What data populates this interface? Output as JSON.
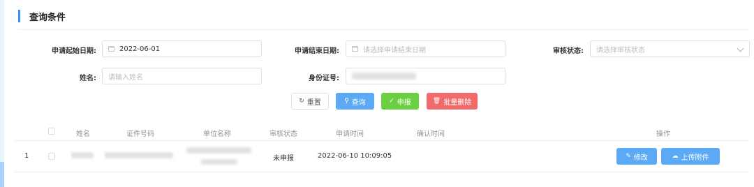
{
  "section": {
    "title": "查询条件"
  },
  "form": {
    "start_date_label": "申请起始日期:",
    "start_date_value": "2022-06-01",
    "end_date_label": "申请结束日期:",
    "end_date_placeholder": "请选择申请结束日期",
    "status_label": "审核状态:",
    "status_placeholder": "请选择审核状态",
    "name_label": "姓名:",
    "name_placeholder": "请输入姓名",
    "id_label": "身份证号:"
  },
  "buttons": {
    "reset": "重置",
    "query": "查询",
    "report": "申报",
    "batch_delete": "批量删除"
  },
  "table": {
    "headers": [
      "姓名",
      "证件号码",
      "单位名称",
      "审核状态",
      "申请时间",
      "确认时间",
      "操作"
    ],
    "rows": [
      {
        "index": "1",
        "status": "未申报",
        "apply_time": "2022-06-10 10:09:05",
        "confirm_time": "",
        "actions": {
          "edit": "修改",
          "upload": "上传附件"
        }
      }
    ]
  },
  "icons": {
    "reset": "refresh-icon",
    "query": "search-icon",
    "report": "check-circle-icon",
    "delete": "trash-icon",
    "edit": "edit-icon",
    "upload": "cloud-upload-icon"
  },
  "colors": {
    "primary": "#5ca9f5",
    "success": "#6ccf42",
    "danger": "#f26b6b",
    "accent": "#3e8ef7"
  }
}
